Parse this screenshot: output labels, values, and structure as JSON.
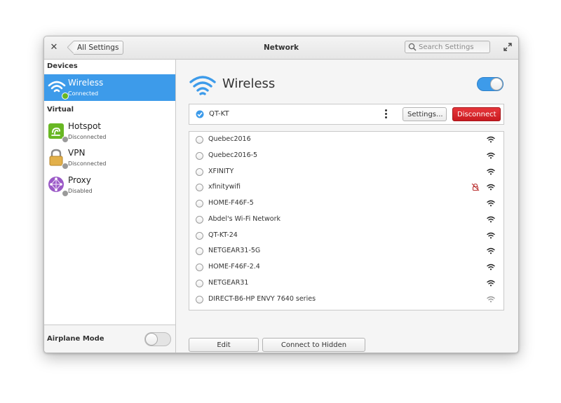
{
  "window": {
    "title": "Network",
    "back_label": "All Settings",
    "search_placeholder": "Search Settings"
  },
  "sidebar": {
    "sections": {
      "devices": "Devices",
      "virtual": "Virtual"
    },
    "items": [
      {
        "name": "Wireless",
        "status": "Connected",
        "selected": true,
        "icon": "wifi-icon"
      },
      {
        "name": "Hotspot",
        "status": "Disconnected",
        "selected": false,
        "icon": "hotspot-icon"
      },
      {
        "name": "VPN",
        "status": "Disconnected",
        "selected": false,
        "icon": "vpn-lock-icon"
      },
      {
        "name": "Proxy",
        "status": "Disabled",
        "selected": false,
        "icon": "proxy-globe-icon"
      }
    ],
    "airplane_mode": {
      "label": "Airplane Mode",
      "enabled": false
    }
  },
  "content": {
    "title": "Wireless",
    "wireless_enabled": true,
    "active_network": {
      "ssid": "QT-KT",
      "settings_label": "Settings...",
      "disconnect_label": "Disconnect"
    },
    "networks": [
      {
        "ssid": "Quebec2016"
      },
      {
        "ssid": "Quebec2016-5"
      },
      {
        "ssid": "XFINITY"
      },
      {
        "ssid": "xfinitywifi",
        "insecure": true
      },
      {
        "ssid": "HOME-F46F-5"
      },
      {
        "ssid": "Abdel's Wi-Fi Network"
      },
      {
        "ssid": "QT-KT-24"
      },
      {
        "ssid": "NETGEAR31-5G"
      },
      {
        "ssid": "HOME-F46F-2.4"
      },
      {
        "ssid": "NETGEAR31"
      },
      {
        "ssid": "DIRECT-B6-HP ENVY 7640 series",
        "weak": true
      }
    ],
    "edit_connections_label": "Edit Connections...",
    "connect_hidden_label": "Connect to Hidden Network..."
  },
  "colors": {
    "accent": "#3d9bea",
    "danger": "#d4262b",
    "connected": "#68b723"
  }
}
